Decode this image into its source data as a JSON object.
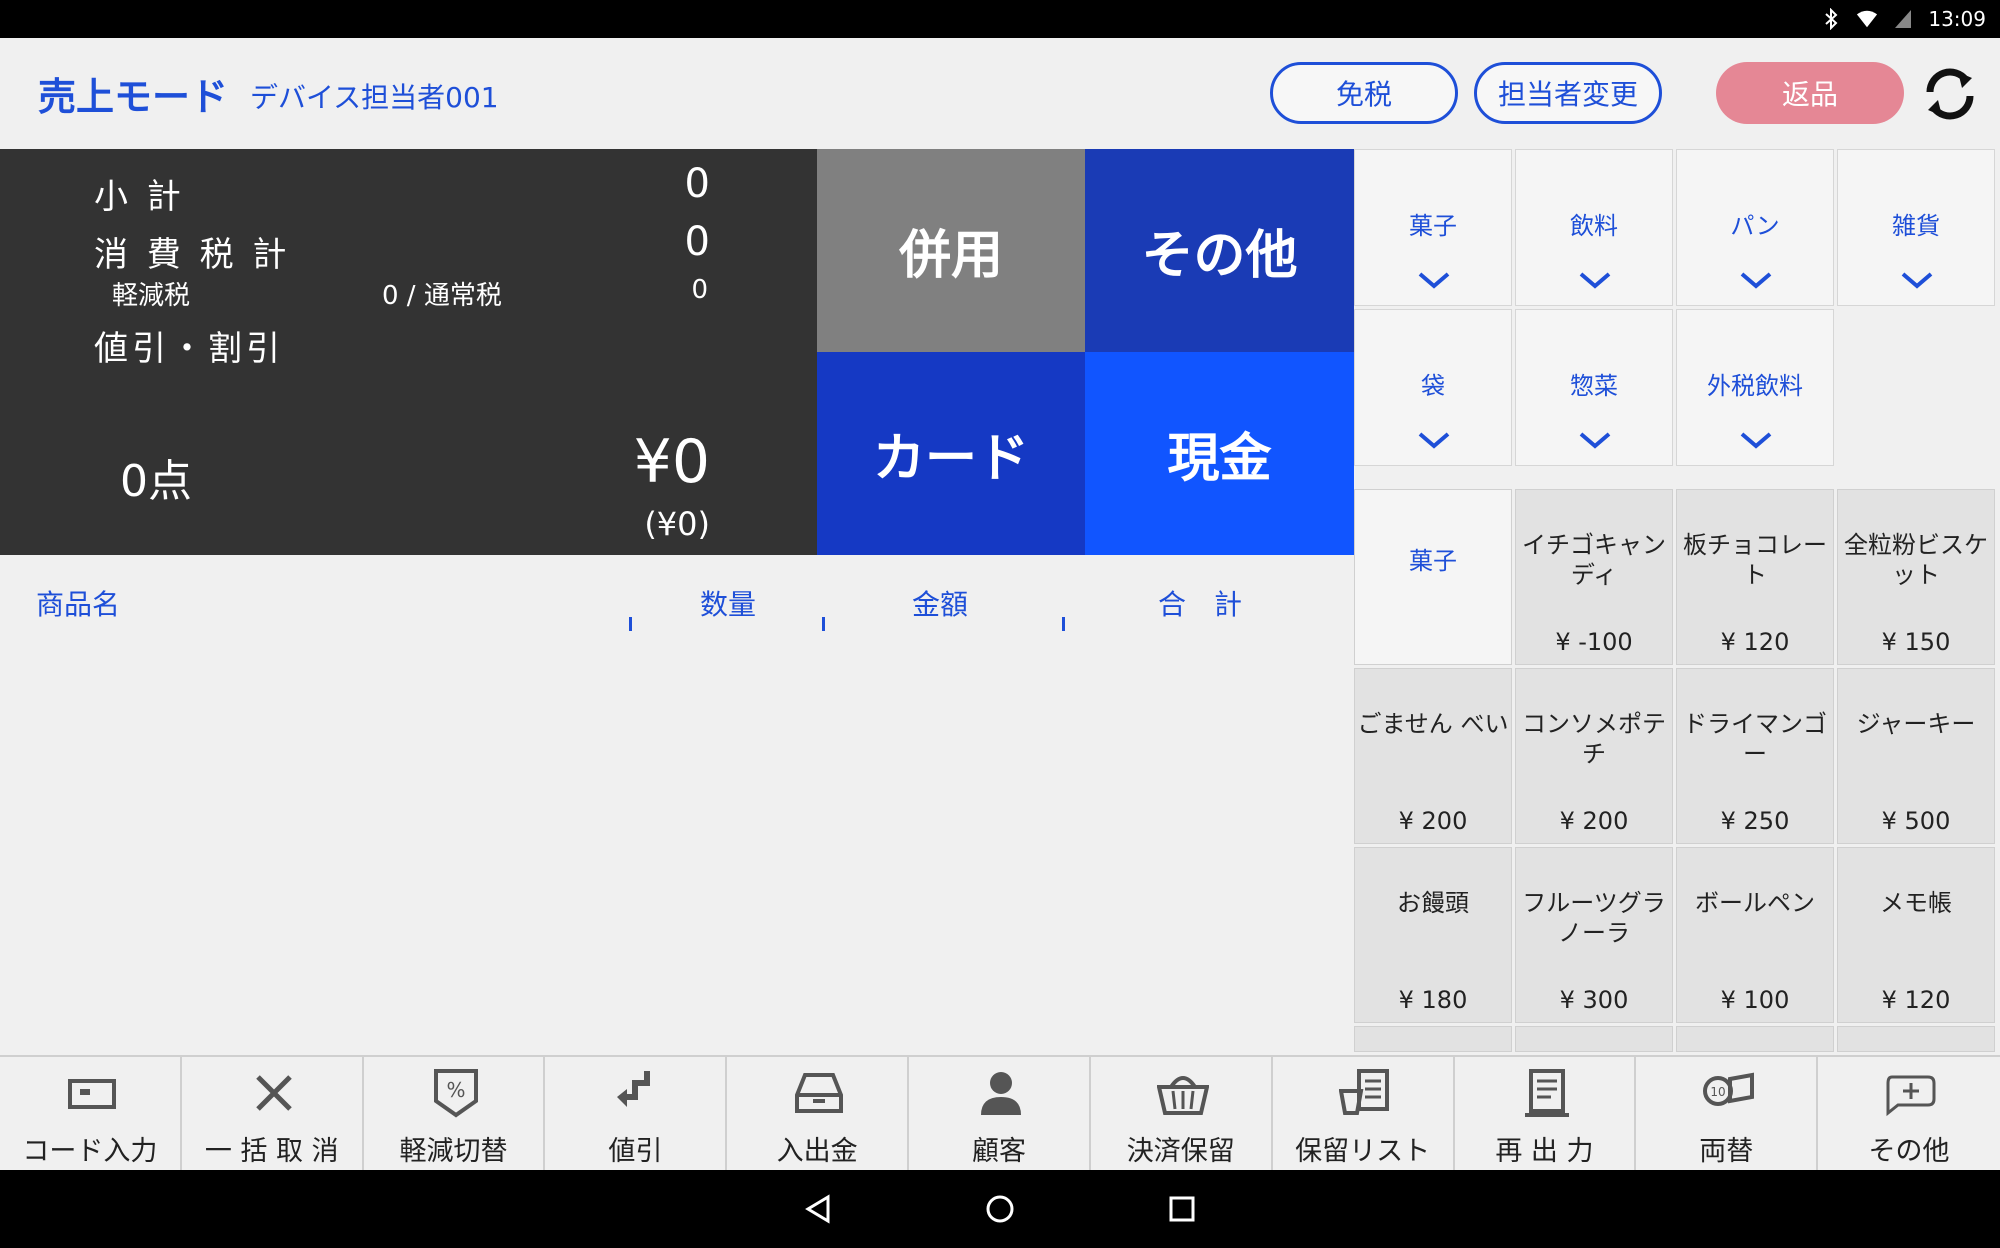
{
  "status_bar": {
    "time": "13:09"
  },
  "header": {
    "mode_title": "売上モード",
    "device_user": "デバイス担当者001",
    "tax_free_label": "免税",
    "change_staff_label": "担当者変更",
    "return_label": "返品"
  },
  "summary": {
    "subtotal_label": "小 計",
    "subtotal_value": "0",
    "tax_total_label": "消 費 税 計",
    "tax_total_value": "0",
    "reduced_tax_label": "軽減税",
    "reduced_tax_text": "0 / 通常税",
    "normal_tax_value": "0",
    "discount_label": "値引・割引",
    "item_count": "0点",
    "total": "¥0",
    "total_sub": "(¥0)"
  },
  "payment": {
    "combined_label": "併用",
    "other_label": "その他",
    "card_label": "カード",
    "cash_label": "現金"
  },
  "table": {
    "col_name": "商品名",
    "col_qty": "数量",
    "col_amount": "金額",
    "col_total": "合　計"
  },
  "categories": [
    "菓子",
    "飲料",
    "パン",
    "雑貨",
    "袋",
    "惣菜",
    "外税飲料"
  ],
  "product_panel": {
    "current_category": "菓子",
    "products": [
      {
        "name": "イチゴキャンディ",
        "price": "¥ -100"
      },
      {
        "name": "板チョコレート",
        "price": "¥ 120"
      },
      {
        "name": "全粒粉ビスケット",
        "price": "¥ 150"
      },
      {
        "name": "ごません べい",
        "price": "¥ 200"
      },
      {
        "name": "コンソメポテチ",
        "price": "¥ 200"
      },
      {
        "name": "ドライマンゴー",
        "price": "¥ 250"
      },
      {
        "name": "ジャーキー",
        "price": "¥ 500"
      },
      {
        "name": "お饅頭",
        "price": "¥ 180"
      },
      {
        "name": "フルーツグラノーラ",
        "price": "¥ 300"
      },
      {
        "name": "ボールペン",
        "price": "¥ 100"
      },
      {
        "name": "メモ帳",
        "price": "¥ 120"
      }
    ]
  },
  "toolbar": {
    "items": [
      {
        "label": "コード入力",
        "icon": "tag-icon"
      },
      {
        "label": "一 括 取 消",
        "icon": "close-icon"
      },
      {
        "label": "軽減切替",
        "icon": "percent-tag-icon"
      },
      {
        "label": "値引",
        "icon": "discount-arrow-icon"
      },
      {
        "label": "入出金",
        "icon": "drawer-icon"
      },
      {
        "label": "顧客",
        "icon": "person-icon"
      },
      {
        "label": "決済保留",
        "icon": "basket-icon"
      },
      {
        "label": "保留リスト",
        "icon": "hold-list-icon"
      },
      {
        "label": "再 出 力",
        "icon": "receipt-icon"
      },
      {
        "label": "両替",
        "icon": "coins-icon"
      },
      {
        "label": "その他",
        "icon": "plus-icon"
      }
    ]
  },
  "colors": {
    "accent": "#1e4fd8",
    "combined": "#808080",
    "other": "#1a3bb5",
    "card": "#1539c4",
    "cash": "#1155ff",
    "return": "#e58795",
    "summary_bg": "#333333"
  }
}
